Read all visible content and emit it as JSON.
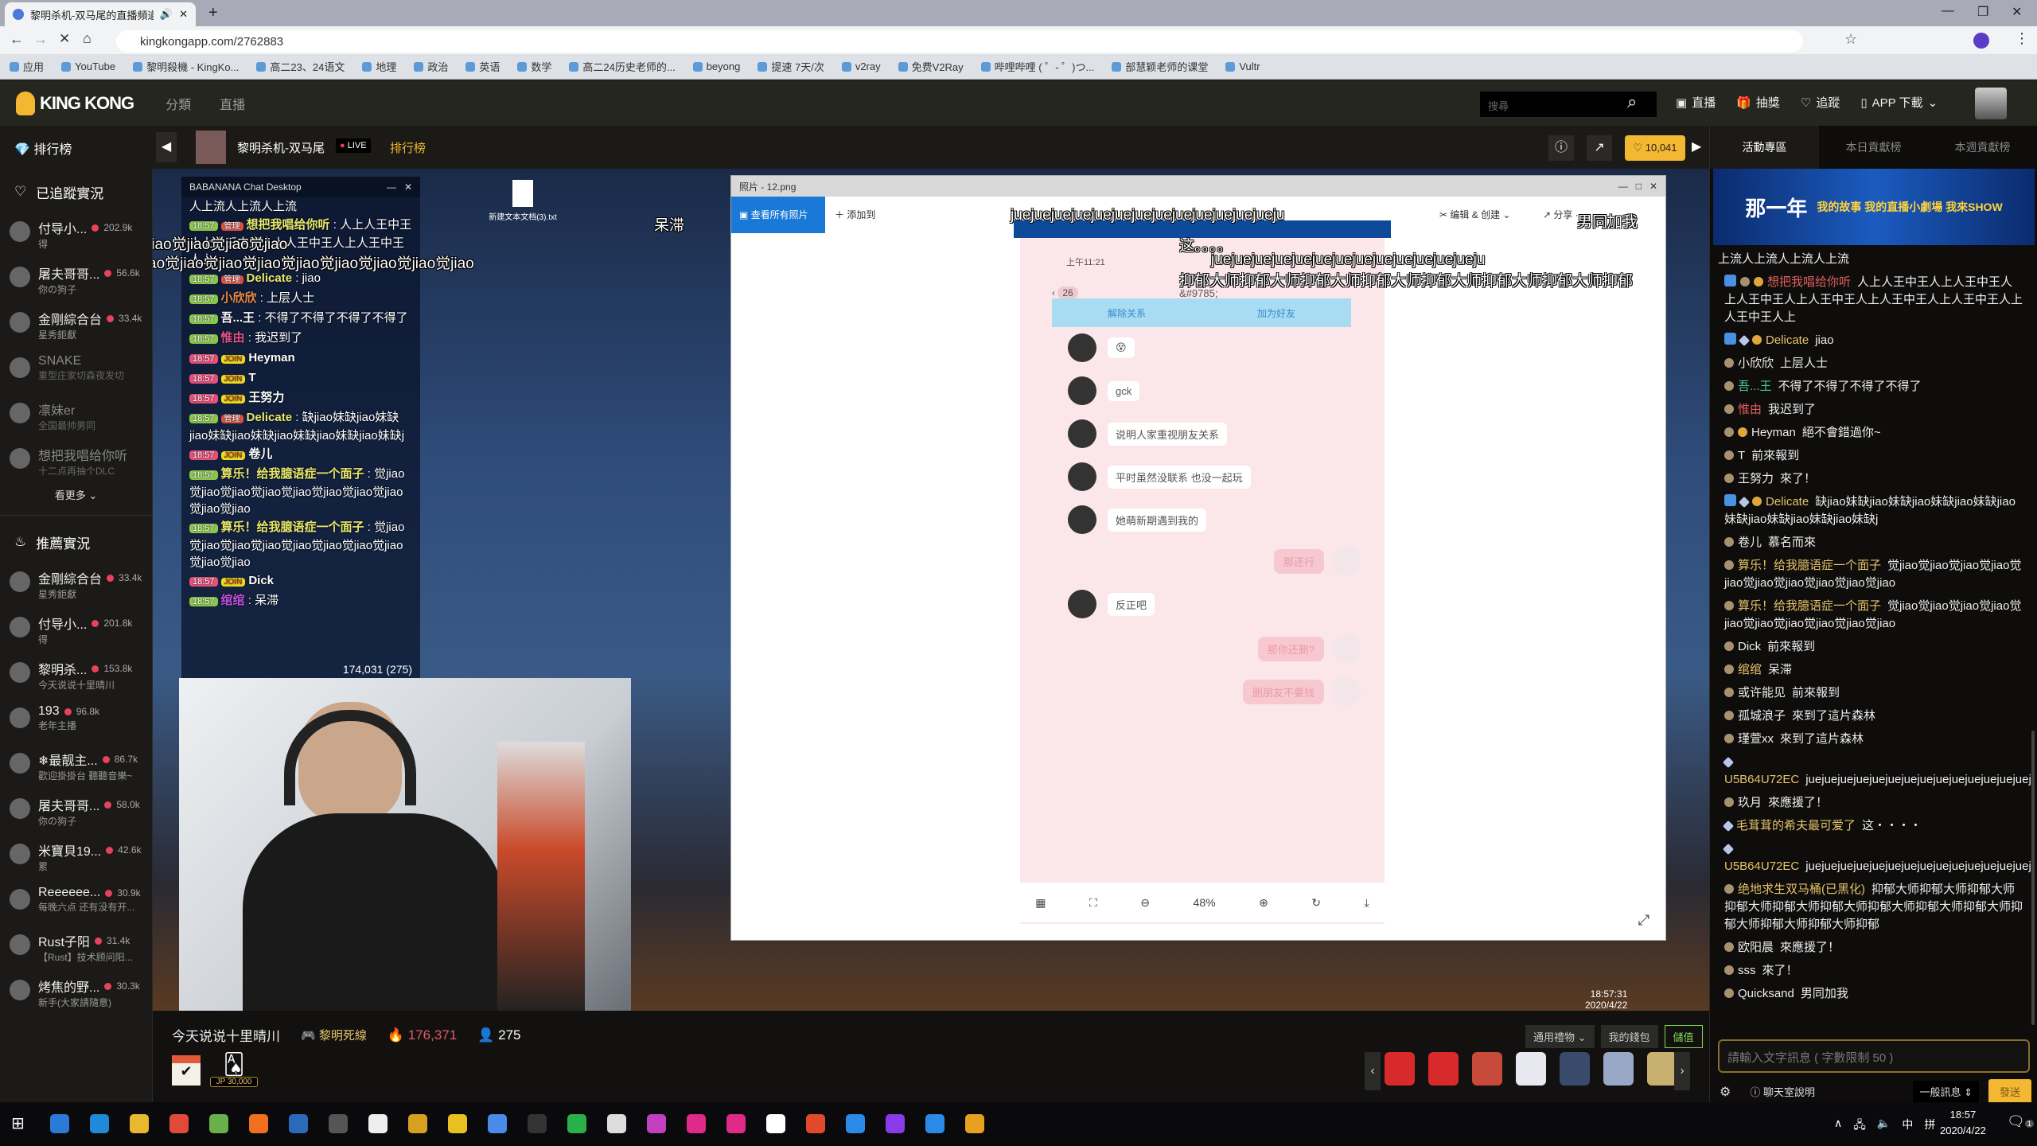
{
  "browser": {
    "tab_title": "黎明杀机-双马尾的直播頻道",
    "url": "kingkongapp.com/2762883",
    "bookmarks": [
      "应用",
      "YouTube",
      "黎明殺機 - KingKo...",
      "高二23、24语文",
      "地理",
      "政治",
      "英语",
      "数学",
      "高二24历史老师的...",
      "beyong",
      "提速 7天/次",
      "v2ray",
      "免费V2Ray",
      "哔哩哔哩 ( ゜- ゜)つ...",
      "部慧颖老师的课堂",
      "Vultr"
    ]
  },
  "header": {
    "logo": "KING KONG",
    "nav": [
      "分類",
      "直播"
    ],
    "search_placeholder": "搜尋",
    "actions": [
      "直播",
      "抽獎",
      "追蹤",
      "APP 下載"
    ]
  },
  "subheader": {
    "rank_label": "排行榜",
    "streamer": "黎明杀机-双马尾",
    "live": "LIVE",
    "rank_link": "排行榜",
    "likes": "10,041"
  },
  "sidebar": {
    "following_title": "已追蹤實況",
    "following": [
      {
        "name": "付导小...",
        "count": "202.9k",
        "sub": "得",
        "live": true
      },
      {
        "name": "屠夫哥哥...",
        "count": "56.6k",
        "sub": "你の狗子",
        "live": true
      },
      {
        "name": "金剛綜合台",
        "count": "33.4k",
        "sub": "星秀鉅獻",
        "live": true
      },
      {
        "name": "SNAKE",
        "count": "",
        "sub": "重型庄家切森夜发切",
        "live": false
      },
      {
        "name": "凛妹er",
        "count": "",
        "sub": "全国最帅男同",
        "live": false
      },
      {
        "name": "想把我唱给你听",
        "count": "",
        "sub": "十二点再抽个DLC",
        "live": false
      }
    ],
    "more": "看更多",
    "recommend_title": "推薦實況",
    "recommend": [
      {
        "name": "金剛綜合台",
        "count": "33.4k",
        "sub": "星秀鉅獻",
        "live": true
      },
      {
        "name": "付导小...",
        "count": "201.8k",
        "sub": "得",
        "live": true
      },
      {
        "name": "黎明杀...",
        "count": "153.8k",
        "sub": "今天说说十里晴川",
        "live": true
      },
      {
        "name": "193",
        "count": "96.8k",
        "sub": "老年主播",
        "live": true
      },
      {
        "name": "❄最靓主...",
        "count": "86.7k",
        "sub": "歡迎掛掛台 聽聽音樂~",
        "live": true
      },
      {
        "name": "屠夫哥哥...",
        "count": "58.0k",
        "sub": "你の狗子",
        "live": true
      },
      {
        "name": "米寶貝19...",
        "count": "42.6k",
        "sub": "累",
        "live": true
      },
      {
        "name": "Reeeeee...",
        "count": "30.9k",
        "sub": "每晚六点 还有没有开...",
        "live": true
      },
      {
        "name": "Rust子阳",
        "count": "31.4k",
        "sub": "【Rust】技术顾问阳...",
        "live": true
      },
      {
        "name": "烤焦的野...",
        "count": "30.3k",
        "sub": "新手(大家請隨意)",
        "live": true
      }
    ]
  },
  "video": {
    "overlay_chat": {
      "title": "BABANANA Chat Desktop",
      "first_line": "人上流人上流人上流",
      "lines": [
        {
          "time": "18:57",
          "kind": "msg",
          "tag": "管理",
          "user": "想把我唱给你听",
          "user_color": "#e8e86a",
          "text": "人上人王中王人上人王中王人上人王中王人上人王中王人上"
        },
        {
          "time": "18:57",
          "kind": "msg",
          "tag": "管理",
          "user": "Delicate",
          "user_color": "#e8e86a",
          "text": "jiao"
        },
        {
          "time": "18:57",
          "kind": "msg",
          "tag": "",
          "user": "小欣欣",
          "user_color": "#f08a4a",
          "text": "上层人士"
        },
        {
          "time": "18:57",
          "kind": "msg",
          "tag": "",
          "user": "吾...王",
          "user_color": "#ffffff",
          "text": "不得了不得了不得了不得了"
        },
        {
          "time": "18:57",
          "kind": "msg",
          "tag": "",
          "user": "惟由",
          "user_color": "#e0508a",
          "text": "我迟到了"
        },
        {
          "time": "18:57",
          "kind": "join",
          "tag": "JOIN",
          "user": "Heyman",
          "user_color": "#ffffff",
          "text": ""
        },
        {
          "time": "18:57",
          "kind": "join",
          "tag": "JOIN",
          "user": "T",
          "user_color": "#ffffff",
          "text": ""
        },
        {
          "time": "18:57",
          "kind": "join",
          "tag": "JOIN",
          "user": "王努力",
          "user_color": "#ffffff",
          "text": ""
        },
        {
          "time": "18:57",
          "kind": "msg",
          "tag": "管理",
          "user": "Delicate",
          "user_color": "#e8e86a",
          "text": "缺jiao妹缺jiao妹缺jiao妹缺jiao妹缺jiao妹缺jiao妹缺jiao妹缺j"
        },
        {
          "time": "18:57",
          "kind": "join",
          "tag": "JOIN",
          "user": "卷儿",
          "user_color": "#ffffff",
          "text": ""
        },
        {
          "time": "18:57",
          "kind": "msg",
          "tag": "",
          "user": "算乐！给我臆语症一个面子",
          "user_color": "#e8e86a",
          "text": "觉jiao觉jiao觉jiao觉jiao觉jiao觉jiao觉jiao觉jiao觉jiao觉jiao"
        },
        {
          "time": "18:57",
          "kind": "msg",
          "tag": "",
          "user": "算乐！给我臆语症一个面子",
          "user_color": "#e8e86a",
          "text": "觉jiao觉jiao觉jiao觉jiao觉jiao觉jiao觉jiao觉jiao觉jiao觉jiao"
        },
        {
          "time": "18:57",
          "kind": "join",
          "tag": "JOIN",
          "user": "Dick",
          "user_color": "#ffffff",
          "text": ""
        },
        {
          "time": "18:57",
          "kind": "msg",
          "tag": "",
          "user": "绾绾",
          "user_color": "#c050e0",
          "text": "呆滞"
        }
      ],
      "footer": "174,031 (275)"
    },
    "danmaku": [
      "jiao觉jiao觉jiao觉jiao",
      "ao觉jiao觉jiao觉jiao觉jiao觉jiao觉jiao觉jiao觉jiao",
      "juejuejuejuejuejuejuejuejuejuejuejuejueju",
      "这。。。。",
      "男同加我",
      "juejuejuejuejuejuejuejuejuejuejuejuejueju",
      "抑郁大师抑郁大师抑郁大师抑郁大师抑郁大师抑郁大师抑郁大师抑郁",
      "呆滞"
    ],
    "desktop_icon": "新建文本文档(3).txt",
    "viewer": {
      "title": "照片 - 12.png",
      "see_all": "查看所有照片",
      "add_to": "添加到",
      "edit_create": "编辑 & 创建",
      "share": "分享",
      "zoom": "48%",
      "phone": {
        "time": "上午11:21",
        "badge": "26",
        "contact": "&#9785;",
        "unlink": "解除关系",
        "add_friend": "加为好友",
        "messages": [
          {
            "side": "left",
            "text": "😵"
          },
          {
            "side": "left",
            "text": "gck"
          },
          {
            "side": "left",
            "text": "说明人家重视朋友关系"
          },
          {
            "side": "left",
            "text": "平时虽然没联系 也没一起玩"
          },
          {
            "side": "left",
            "text": "她萌新期遇到我的"
          },
          {
            "side": "right",
            "text": "那还行"
          },
          {
            "side": "left",
            "text": "反正吧"
          },
          {
            "side": "right",
            "text": "那你还删?"
          },
          {
            "side": "right",
            "text": "删朋友不要钱"
          }
        ]
      }
    },
    "inner_clock": {
      "time": "18:57:31",
      "date": "2020/4/22"
    }
  },
  "info": {
    "title": "今天说说十里晴川",
    "category": "黎明死線",
    "heat": "176,371",
    "viewers": "275",
    "jackpot": "JP 30,000",
    "gift_menu": "通用禮物",
    "wallet": "我的錢包",
    "topup": "儲值",
    "gifts": [
      "red-envelope",
      "red-envelope",
      "rocket",
      "jet",
      "swordsman",
      "granny-shield",
      "granny-box"
    ]
  },
  "right": {
    "tabs": [
      "活動專區",
      "本日貢獻榜",
      "本週貢獻榜"
    ],
    "banner": [
      "那一年",
      "我的故事 我的直播小劇場 我來SHOW"
    ],
    "first_line": "上流人上流人上流人上流",
    "messages": [
      {
        "badges": [
          "sh",
          "bd",
          "co"
        ],
        "user": "想把我唱给你听",
        "color": "#e0605a",
        "text": "人上人王中王人上人王中王人上人王中王人上人王中王人上人王中王人上人王中王人上人王中王人上"
      },
      {
        "badges": [
          "sh",
          "di",
          "co"
        ],
        "user": "Delicate",
        "color": "#e6c36a",
        "text": "jiao"
      },
      {
        "badges": [
          "bd"
        ],
        "user": "小欣欣",
        "color": "#eeeeee",
        "text": "上层人士"
      },
      {
        "badges": [
          "bd"
        ],
        "user": "吾...王",
        "color": "#4fc89a",
        "text": "不得了不得了不得了不得了"
      },
      {
        "badges": [
          "bd"
        ],
        "user": "惟由",
        "color": "#e0605a",
        "text": "我迟到了"
      },
      {
        "badges": [
          "bd",
          "co"
        ],
        "user": "Heyman",
        "color": "#eeeeee",
        "text": "絕不會錯過你~"
      },
      {
        "badges": [
          "bd"
        ],
        "user": "T",
        "color": "#eeeeee",
        "text": "前來報到"
      },
      {
        "badges": [
          "bd"
        ],
        "user": "王努力",
        "color": "#eeeeee",
        "text": "來了！"
      },
      {
        "badges": [
          "sh",
          "di",
          "co"
        ],
        "user": "Delicate",
        "color": "#e6c36a",
        "text": "缺jiao妹缺jiao妹缺jiao妹缺jiao妹缺jiao妹缺jiao妹缺jiao妹缺jiao妹缺j"
      },
      {
        "badges": [
          "bd"
        ],
        "user": "卷儿",
        "color": "#eeeeee",
        "text": "慕名而來"
      },
      {
        "badges": [
          "bd"
        ],
        "user": "算乐！给我臆语症一个面子",
        "color": "#e6c36a",
        "text": "觉jiao觉jiao觉jiao觉jiao觉jiao觉jiao觉jiao觉jiao觉jiao觉jiao"
      },
      {
        "badges": [
          "bd"
        ],
        "user": "算乐！给我臆语症一个面子",
        "color": "#e6c36a",
        "text": "觉jiao觉jiao觉jiao觉jiao觉jiao觉jiao觉jiao觉jiao觉jiao觉jiao"
      },
      {
        "badges": [
          "bd"
        ],
        "user": "Dick",
        "color": "#eeeeee",
        "text": "前來報到"
      },
      {
        "badges": [
          "bd"
        ],
        "user": "绾绾",
        "color": "#e6c36a",
        "text": "呆滞"
      },
      {
        "badges": [
          "bd"
        ],
        "user": "或许能见",
        "color": "#eeeeee",
        "text": "前來報到"
      },
      {
        "badges": [
          "bd"
        ],
        "user": "孤城浪子",
        "color": "#eeeeee",
        "text": "來到了這片森林"
      },
      {
        "badges": [
          "bd"
        ],
        "user": "瑾萱xx",
        "color": "#eeeeee",
        "text": "來到了這片森林"
      },
      {
        "badges": [
          "di"
        ],
        "user": "U5B64U72EC",
        "color": "#e6c36a",
        "text": "juejuejuejuejuejuejuejuejuejuejuejuejuejuejuejueju"
      },
      {
        "badges": [
          "bd"
        ],
        "user": "玖月",
        "color": "#eeeeee",
        "text": "來應援了！"
      },
      {
        "badges": [
          "di"
        ],
        "user": "毛茸茸的希夫最可爱了",
        "color": "#e6c36a",
        "text": "这・・・・"
      },
      {
        "badges": [
          "di"
        ],
        "user": "U5B64U72EC",
        "color": "#e6c36a",
        "text": "juejuejuejuejuejuejuejuejuejuejuejuejuejuejuejueju"
      },
      {
        "badges": [
          "bd"
        ],
        "user": "绝地求生双马桶(已黑化)",
        "color": "#e6c36a",
        "text": "抑郁大师抑郁大师抑郁大师抑郁大师抑郁大师抑郁大师抑郁大师抑郁大师抑郁大师抑郁大师抑郁大师抑郁大师抑郁"
      },
      {
        "badges": [
          "bd"
        ],
        "user": "欧阳晨",
        "color": "#eeeeee",
        "text": "來應援了！"
      },
      {
        "badges": [
          "bd"
        ],
        "user": "sss",
        "color": "#eeeeee",
        "text": "來了！"
      },
      {
        "badges": [
          "bd"
        ],
        "user": "Quicksand",
        "color": "#eeeeee",
        "text": "男同加我"
      }
    ],
    "input_placeholder": "請輸入文字訊息 ( 字數限制 50 )",
    "help": "聊天室說明",
    "msg_type": "一般訊息",
    "send": "發送"
  },
  "taskbar": {
    "ime1": "中",
    "ime2": "拼",
    "time": "18:57",
    "date": "2020/4/22",
    "notifications": "1"
  },
  "colors": {
    "accent": "#f3b731",
    "live": "#e8435b",
    "topup": "#7ed957",
    "heat": "#e05a6a"
  }
}
